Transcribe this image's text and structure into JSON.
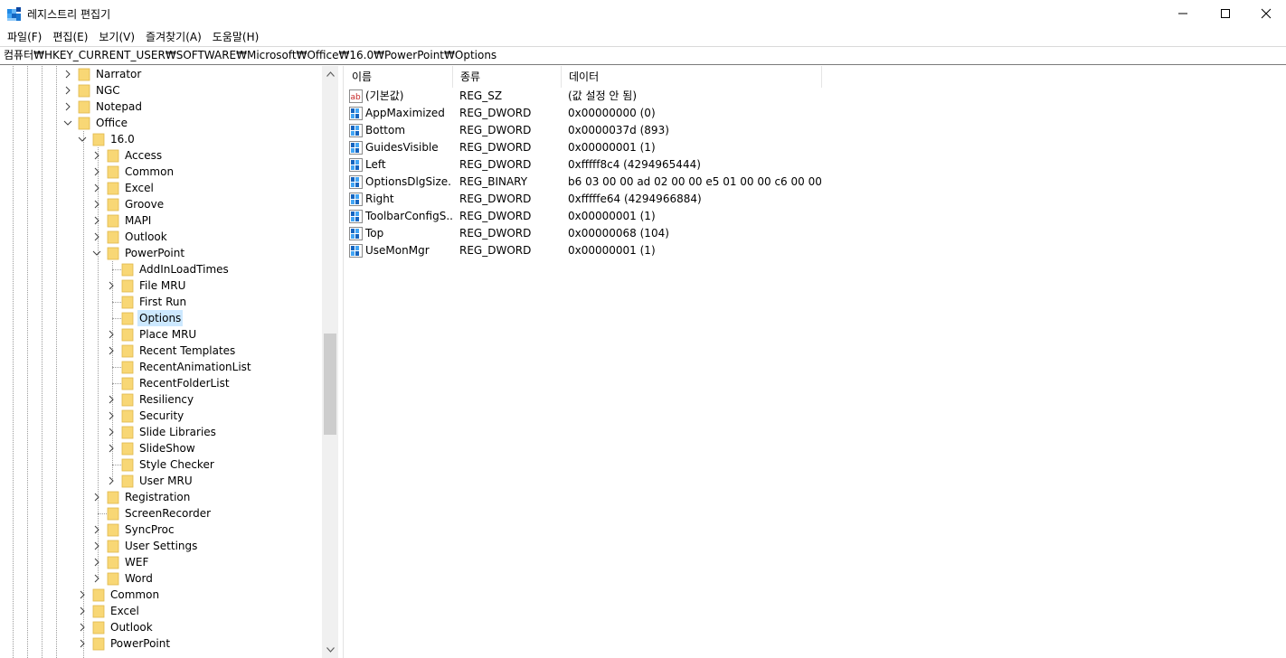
{
  "window": {
    "title": "레지스트리 편집기",
    "icon": "registry-editor-icon",
    "buttons": {
      "minimize": "minimize-icon",
      "maximize": "maximize-icon",
      "close": "close-icon"
    }
  },
  "menu": [
    "파일(F)",
    "편집(E)",
    "보기(V)",
    "즐겨찾기(A)",
    "도움말(H)"
  ],
  "address": "컴퓨터₩HKEY_CURRENT_USER₩SOFTWARE₩Microsoft₩Office₩16.0₩PowerPoint₩Options",
  "tree": [
    {
      "label": "Narrator",
      "level": 0,
      "expander": "collapsed"
    },
    {
      "label": "NGC",
      "level": 0,
      "expander": "collapsed"
    },
    {
      "label": "Notepad",
      "level": 0,
      "expander": "collapsed"
    },
    {
      "label": "Office",
      "level": 0,
      "expander": "expanded"
    },
    {
      "label": "16.0",
      "level": 1,
      "expander": "expanded"
    },
    {
      "label": "Access",
      "level": 2,
      "expander": "collapsed"
    },
    {
      "label": "Common",
      "level": 2,
      "expander": "collapsed"
    },
    {
      "label": "Excel",
      "level": 2,
      "expander": "collapsed"
    },
    {
      "label": "Groove",
      "level": 2,
      "expander": "collapsed"
    },
    {
      "label": "MAPI",
      "level": 2,
      "expander": "collapsed"
    },
    {
      "label": "Outlook",
      "level": 2,
      "expander": "collapsed"
    },
    {
      "label": "PowerPoint",
      "level": 2,
      "expander": "expanded"
    },
    {
      "label": "AddInLoadTimes",
      "level": 3,
      "expander": "none"
    },
    {
      "label": "File MRU",
      "level": 3,
      "expander": "collapsed"
    },
    {
      "label": "First Run",
      "level": 3,
      "expander": "none"
    },
    {
      "label": "Options",
      "level": 3,
      "expander": "none",
      "selected": true
    },
    {
      "label": "Place MRU",
      "level": 3,
      "expander": "collapsed"
    },
    {
      "label": "Recent Templates",
      "level": 3,
      "expander": "collapsed"
    },
    {
      "label": "RecentAnimationList",
      "level": 3,
      "expander": "none"
    },
    {
      "label": "RecentFolderList",
      "level": 3,
      "expander": "none"
    },
    {
      "label": "Resiliency",
      "level": 3,
      "expander": "collapsed"
    },
    {
      "label": "Security",
      "level": 3,
      "expander": "collapsed"
    },
    {
      "label": "Slide Libraries",
      "level": 3,
      "expander": "collapsed"
    },
    {
      "label": "SlideShow",
      "level": 3,
      "expander": "collapsed"
    },
    {
      "label": "Style Checker",
      "level": 3,
      "expander": "none"
    },
    {
      "label": "User MRU",
      "level": 3,
      "expander": "collapsed"
    },
    {
      "label": "Registration",
      "level": 2,
      "expander": "collapsed"
    },
    {
      "label": "ScreenRecorder",
      "level": 2,
      "expander": "none"
    },
    {
      "label": "SyncProc",
      "level": 2,
      "expander": "collapsed"
    },
    {
      "label": "User Settings",
      "level": 2,
      "expander": "collapsed"
    },
    {
      "label": "WEF",
      "level": 2,
      "expander": "collapsed"
    },
    {
      "label": "Word",
      "level": 2,
      "expander": "collapsed"
    },
    {
      "label": "Common",
      "level": 1,
      "expander": "collapsed"
    },
    {
      "label": "Excel",
      "level": 1,
      "expander": "collapsed"
    },
    {
      "label": "Outlook",
      "level": 1,
      "expander": "collapsed"
    },
    {
      "label": "PowerPoint",
      "level": 1,
      "expander": "collapsed"
    }
  ],
  "values": {
    "headers": [
      "이름",
      "종류",
      "데이터"
    ],
    "rows": [
      {
        "icon": "string-value-icon",
        "name": "(기본값)",
        "type": "REG_SZ",
        "data": "(값 설정 안 됨)"
      },
      {
        "icon": "binary-value-icon",
        "name": "AppMaximized",
        "type": "REG_DWORD",
        "data": "0x00000000 (0)"
      },
      {
        "icon": "binary-value-icon",
        "name": "Bottom",
        "type": "REG_DWORD",
        "data": "0x0000037d (893)"
      },
      {
        "icon": "binary-value-icon",
        "name": "GuidesVisible",
        "type": "REG_DWORD",
        "data": "0x00000001 (1)"
      },
      {
        "icon": "binary-value-icon",
        "name": "Left",
        "type": "REG_DWORD",
        "data": "0xfffff8c4 (4294965444)"
      },
      {
        "icon": "binary-value-icon",
        "name": "OptionsDlgSize...",
        "type": "REG_BINARY",
        "data": "b6 03 00 00 ad 02 00 00 e5 01 00 00 c6 00 00 ..."
      },
      {
        "icon": "binary-value-icon",
        "name": "Right",
        "type": "REG_DWORD",
        "data": "0xfffffe64 (4294966884)"
      },
      {
        "icon": "binary-value-icon",
        "name": "ToolbarConfigS...",
        "type": "REG_DWORD",
        "data": "0x00000001 (1)"
      },
      {
        "icon": "binary-value-icon",
        "name": "Top",
        "type": "REG_DWORD",
        "data": "0x00000068 (104)"
      },
      {
        "icon": "binary-value-icon",
        "name": "UseMonMgr",
        "type": "REG_DWORD",
        "data": "0x00000001 (1)"
      }
    ]
  },
  "colors": {
    "selection": "#cce8ff",
    "folder": "#f8d775",
    "folder_dark": "#e0b84a",
    "accent": "#0078d7"
  }
}
